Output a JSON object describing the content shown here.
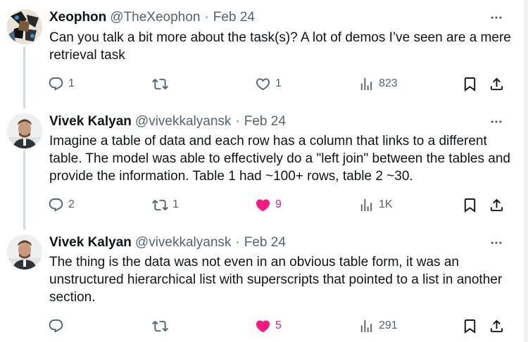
{
  "tweets": [
    {
      "name": "Xeophon",
      "handle": "@TheXeophon",
      "dot": "·",
      "date": "Feb 24",
      "text": "Can you talk a bit more about the task(s)? A lot of demos I’ve seen are a mere retrieval task",
      "stats": {
        "replies": "1",
        "reposts": "",
        "likes": "1",
        "views": "823"
      },
      "liked": false
    },
    {
      "name": "Vivek Kalyan",
      "handle": "@vivekkalyansk",
      "dot": "·",
      "date": "Feb 24",
      "text": "Imagine a table of data and each row has a column that links to a different table. The model was able to effectively do a \"left join\" between the tables and provide the information. Table 1 had ~100+ rows, table 2 ~30.",
      "stats": {
        "replies": "2",
        "reposts": "1",
        "likes": "9",
        "views": "1K"
      },
      "liked": true
    },
    {
      "name": "Vivek Kalyan",
      "handle": "@vivekkalyansk",
      "dot": "·",
      "date": "Feb 24",
      "text": "The thing is the data was not even in an obvious table form, it was an unstructured hierarchical list with superscripts that pointed to a list in another section.",
      "stats": {
        "replies": "",
        "reposts": "",
        "likes": "5",
        "views": "291"
      },
      "liked": true
    }
  ],
  "icons": {
    "reply": "reply-icon",
    "repost": "repost-icon",
    "like": "heart-icon",
    "views": "views-chart-icon",
    "bookmark": "bookmark-icon",
    "share": "share-icon",
    "more": "more-dots-icon"
  },
  "colors": {
    "text": "#0f1419",
    "secondary": "#536471",
    "like": "#f91880",
    "thread_line": "#cfd9de"
  }
}
